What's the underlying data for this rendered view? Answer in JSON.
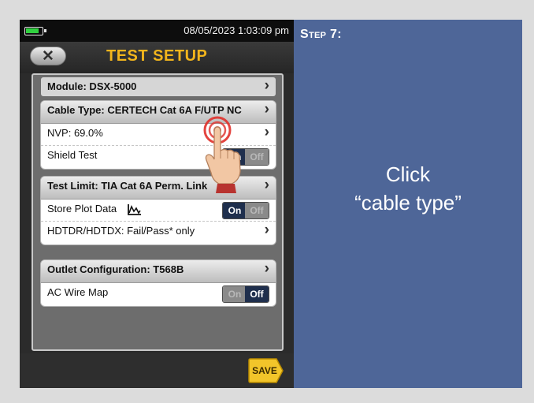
{
  "status_bar": {
    "datetime": "08/05/2023 1:03:09 pm",
    "battery_icon": "battery-icon",
    "battery_color": "#31d140"
  },
  "header": {
    "title": "TEST SETUP",
    "back_icon": "close-x-icon",
    "title_color": "#f2b51c"
  },
  "module": {
    "label": "Module: DSX-5000"
  },
  "cable_group": {
    "header": "Cable Type: CERTECH Cat 6A F/UTP NC",
    "nvp": "NVP: 69.0%",
    "shield_test": {
      "label": "Shield Test",
      "on": "On",
      "off": "Off",
      "state": "On"
    }
  },
  "limit_group": {
    "header": "Test Limit: TIA Cat 6A Perm. Link",
    "store_plot": {
      "label": "Store Plot Data",
      "icon": "plot-graph-icon",
      "on": "On",
      "off": "Off",
      "state": "On"
    },
    "hdtdr": "HDTDR/HDTDX: Fail/Pass* only"
  },
  "outlet_group": {
    "header": "Outlet Configuration: T568B",
    "ac_wire_map": {
      "label": "AC Wire Map",
      "on": "On",
      "off": "Off",
      "state": "Off"
    }
  },
  "footer": {
    "save_label": "SAVE",
    "save_color": "#f2c52a"
  },
  "instruction": {
    "step": "Step 7:",
    "line1": "Click",
    "line2": "“cable type”",
    "panel_color": "#4e6698"
  }
}
